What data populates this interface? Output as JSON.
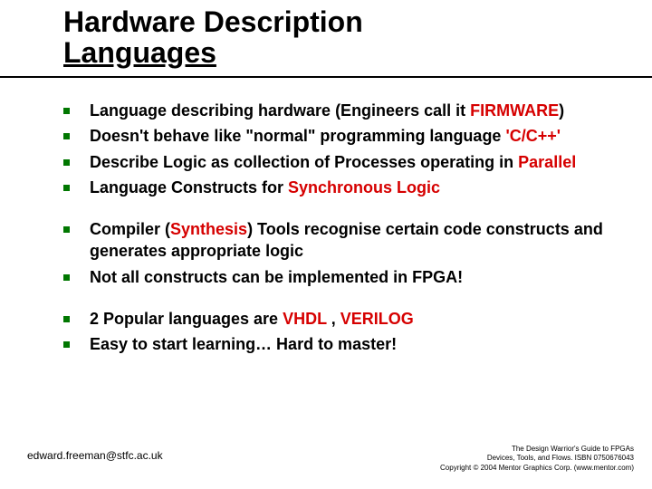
{
  "title_line1": "Hardware Description",
  "title_line2": "Languages",
  "groups": [
    [
      {
        "plain": "Language describing hardware (Engineers call it ",
        "red": "FIRMWARE",
        "after": ")"
      },
      {
        "plain": "Doesn't behave like \"normal\" programming language ",
        "red": "'C/C++'",
        "after": ""
      },
      {
        "plain": "Describe Logic as collection of Processes operating in ",
        "red": "Parallel",
        "after": ""
      },
      {
        "plain": "Language Constructs for ",
        "red": "Synchronous Logic",
        "after": ""
      }
    ],
    [
      {
        "plain": "Compiler (",
        "red": "Synthesis",
        "after": ") Tools recognise certain code constructs and generates appropriate logic"
      },
      {
        "plain": "Not all constructs can be implemented in FPGA!",
        "red": "",
        "after": ""
      }
    ],
    [
      {
        "plain": "2 Popular languages are ",
        "red": "VHDL",
        "mid": " , ",
        "red2": "VERILOG",
        "after": ""
      },
      {
        "plain": "Easy to start learning… Hard to master!",
        "red": "",
        "after": ""
      }
    ]
  ],
  "footer_left": "edward.freeman@stfc.ac.uk",
  "footer_right": [
    "The Design Warrior's Guide to FPGAs",
    "Devices, Tools, and Flows. ISBN 0750676043",
    "Copyright © 2004 Mentor Graphics Corp. (www.mentor.com)"
  ]
}
